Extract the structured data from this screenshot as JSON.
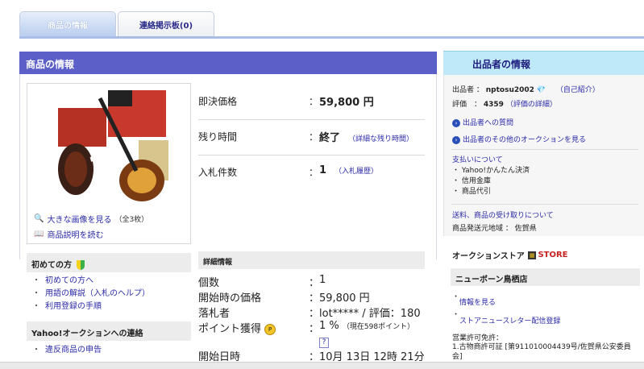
{
  "tabs": [
    {
      "label": "商品の情報",
      "active": true
    },
    {
      "label": "連絡掲示板(0)",
      "active": false
    }
  ],
  "main": {
    "title": "商品の情報",
    "image_links": {
      "large_image": "大きな画像を見る",
      "large_image_count": "（全3枚）",
      "read_description": "商品説明を読む"
    },
    "price_rows": [
      {
        "label": "即決価格",
        "value": "59,800 円",
        "note": ""
      },
      {
        "label": "残り時間",
        "value": "終了",
        "note": "（詳細な残り時間）"
      },
      {
        "label": "入札件数",
        "value": "1",
        "note": "（入札履歴）"
      }
    ]
  },
  "guide": {
    "title": "初めての方",
    "items": [
      "初めての方へ",
      "用語の解説（入札のヘルプ）",
      "利用登録の手順"
    ],
    "contact_title": "Yahoo!オークションへの連絡",
    "contact_items": [
      "違反商品の申告"
    ]
  },
  "detail": {
    "title": "詳細情報",
    "rows": [
      {
        "label": "個数",
        "value": "1"
      },
      {
        "label": "開始時の価格",
        "value": "59,800 円"
      },
      {
        "label": "落札者",
        "value": "lot***** / 評価：180"
      },
      {
        "label": "ポイント獲得",
        "value": "1 %",
        "note": "（現在598ポイント）"
      },
      {
        "label": "開始日時",
        "value": "10月 13日 12時 21分"
      }
    ]
  },
  "seller": {
    "title": "出品者の情報",
    "seller_label": "出品者",
    "seller_id": "nptosu2002",
    "self_intro": "（自己紹介）",
    "rating_label": "評価",
    "rating_value": "4359",
    "rating_detail": "（評価の詳細）",
    "ask_link": "出品者への質問",
    "other_auctions": "出品者のその他のオークションを見る",
    "payment_title": "支払いについて",
    "payment_items": [
      "Yahoo!かんたん決済",
      "信用金庫",
      "商品代引"
    ],
    "shipping_title": "送料、商品の受け取りについて",
    "ship_from_label": "商品発送元地域",
    "ship_from_value": "佐賀県"
  },
  "store": {
    "title": "オークションストア",
    "badge": "STORE",
    "name": "ニューボーン鳥栖店",
    "links": [
      "情報を見る",
      "ストアニュースレター配信登録"
    ],
    "license_label": "営業許可免許：",
    "license_text": "1.古物商許可証 [第911010004439号/佐賀県公安委員会]"
  },
  "colors": {
    "main_header": "#5d5fc9",
    "seller_header": "#bfe8f8",
    "link": "#2a2aa8"
  }
}
